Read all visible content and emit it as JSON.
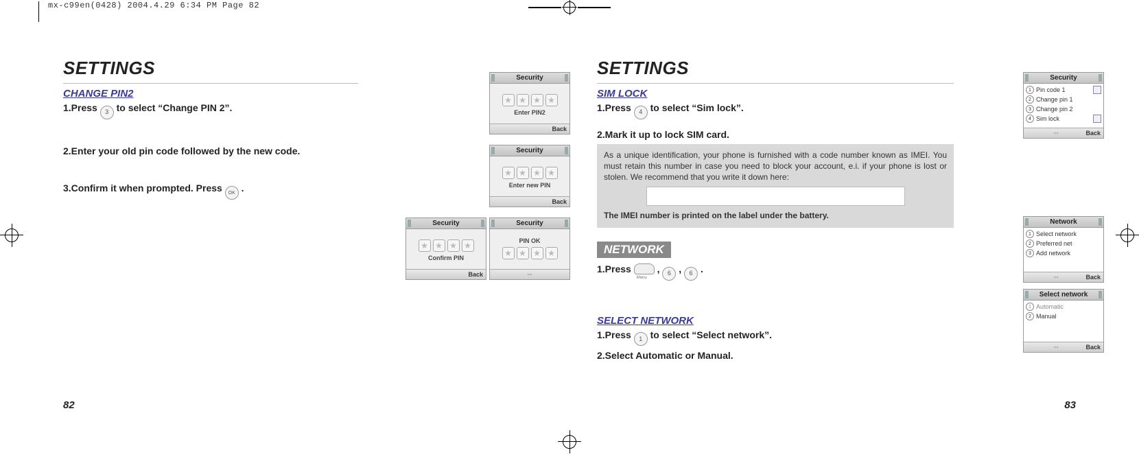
{
  "crop_line": "mx-c99en(0428)  2004.4.29  6:34 PM  Page 82",
  "softkey_back": "Back",
  "nav_center_glyph": "⇔",
  "star_glyph": "★",
  "left": {
    "section": "SETTINGS",
    "change_pin2": {
      "title": "CHANGE PIN2",
      "step1_a": "1.Press ",
      "step1_key": "3",
      "step1_b": " to select “Change PIN 2”.",
      "step2": "2.Enter your old pin code followed by the new code.",
      "step3_a": "3.Confirm it when prompted. Press ",
      "step3_key": "OK",
      "step3_b": " ."
    },
    "phones": {
      "p1": {
        "title": "Security",
        "caption": "Enter PIN2"
      },
      "p2": {
        "title": "Security",
        "caption": "Enter new PIN"
      },
      "p3": {
        "title": "Security",
        "caption": "PIN OK"
      },
      "p4": {
        "title": "Security",
        "caption": "Confirm PIN"
      }
    },
    "pagenum": "82"
  },
  "right": {
    "section": "SETTINGS",
    "sim_lock": {
      "title": "SIM LOCK",
      "step1_a": "1.Press ",
      "step1_key": "4",
      "step1_b": " to select “Sim lock”.",
      "step2": "2.Mark it up to lock SIM card.",
      "info_body": "As a unique identification, your phone is furnished with a code number known as IMEI. You must retain this number in case you need to block your account, e.i. if your phone is lost or stolen. We recommend that you write it down here:",
      "info_footer": "The IMEI number is printed on the label under the battery."
    },
    "network": {
      "label": "NETWORK",
      "step1_a": "1.Press ",
      "step1_key1": "6",
      "step1_key2": "6",
      "step1_b": " ."
    },
    "select_net": {
      "title": "SELECT NETWORK",
      "step1_a": "1.Press ",
      "step1_key": "1",
      "step1_b": " to select “Select network”.",
      "step2": "2.Select Automatic or Manual."
    },
    "phones": {
      "security": {
        "title": "Security",
        "items": [
          "Pin code 1",
          "Change pin 1",
          "Change pin 2",
          "Sim lock"
        ]
      },
      "network": {
        "title": "Network",
        "items": [
          "Select network",
          "Preferred net",
          "Add network"
        ]
      },
      "selectnet": {
        "title": "Select network",
        "items": [
          "Automatic",
          "Manual"
        ]
      }
    },
    "pagenum": "83"
  }
}
